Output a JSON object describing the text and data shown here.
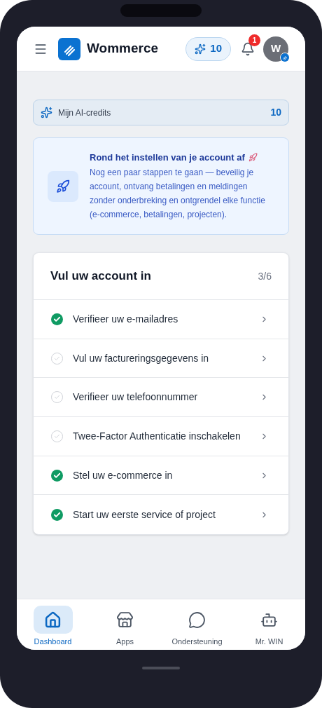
{
  "header": {
    "brand": "Wommerce",
    "credits_badge": "10",
    "notification_count": "1",
    "avatar_initial": "W"
  },
  "credits": {
    "label": "Mijn AI-credits",
    "value": "10"
  },
  "banner": {
    "title": "Rond het instellen van je account af",
    "text": "Nog een paar stappen te gaan — beveilig je account, ontvang betalingen en meldingen zonder onderbreking en ontgrendel elke functie (e-commerce, betalingen, projecten)."
  },
  "checklist": {
    "title": "Vul uw account in",
    "progress": "3/6",
    "items": [
      {
        "label": "Verifieer uw e-mailadres",
        "checked": true
      },
      {
        "label": "Vul uw factureringsgegevens in",
        "checked": false
      },
      {
        "label": "Verifieer uw telefoonnummer",
        "checked": false
      },
      {
        "label": "Twee-Factor Authenticatie inschakelen",
        "checked": false
      },
      {
        "label": "Stel uw e-commerce in",
        "checked": true
      },
      {
        "label": "Start uw eerste service of project",
        "checked": true
      }
    ]
  },
  "bottom_nav": [
    {
      "kind": "home",
      "label": "Dashboard",
      "selected": true
    },
    {
      "kind": "store",
      "label": "Apps",
      "selected": false
    },
    {
      "kind": "chat",
      "label": "Ondersteuning",
      "selected": false
    },
    {
      "kind": "bot",
      "label": "Mr. WIN",
      "selected": false
    }
  ]
}
